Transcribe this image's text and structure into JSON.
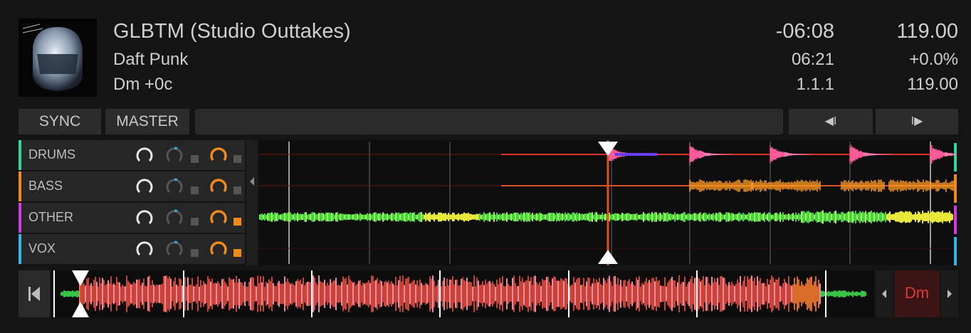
{
  "track": {
    "title": "GLBTM (Studio Outtakes)",
    "artist": "Daft Punk",
    "key": "Dm +0c"
  },
  "readouts": {
    "remaining": "-06:08",
    "bpm": "119.00",
    "length": "06:21",
    "pitch": "+0.0%",
    "position": "1.1.1",
    "base_bpm": "119.00"
  },
  "controls": {
    "sync": "SYNC",
    "master": "MASTER",
    "jump_back": "◀I",
    "jump_forward": "I▶"
  },
  "stems": [
    {
      "name": "DRUMS",
      "color": "#2fd6a0",
      "filter_on": false
    },
    {
      "name": "BASS",
      "color": "#f08a1c",
      "filter_on": false
    },
    {
      "name": "OTHER",
      "color": "#d43ae0",
      "filter_on": true
    },
    {
      "name": "VOX",
      "color": "#32b6e8",
      "filter_on": true
    }
  ],
  "key_display": {
    "key": "Dm",
    "color": "#e0393e"
  },
  "colors": {
    "accent": "#f08a1c",
    "playhead": "#e0501c"
  }
}
